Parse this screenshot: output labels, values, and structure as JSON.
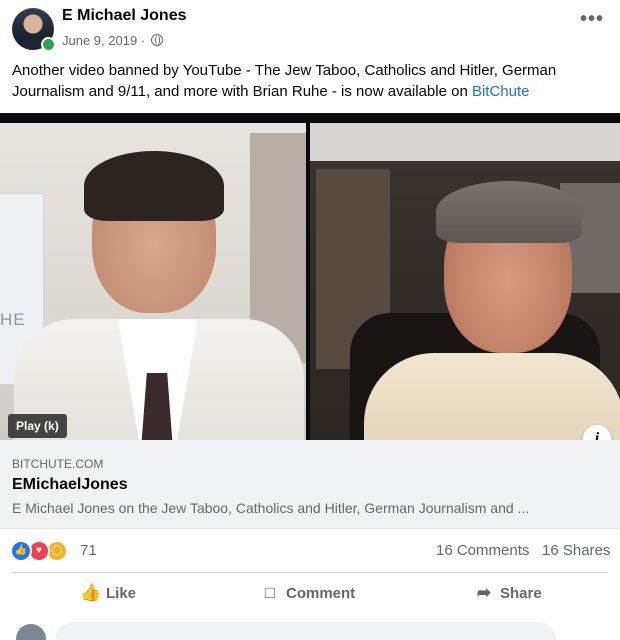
{
  "post": {
    "author": "E Michael Jones",
    "date": "June 9, 2019 ·",
    "privacy_icon": "globe-icon",
    "more_label": "•••",
    "text_before_link": "Another video banned by YouTube - The Jew Taboo, Catholics and Hitler, German Journalism and 9/11, and more with Brian Ruhe - is now available on ",
    "link_text": "BitChute"
  },
  "video": {
    "play_label": "Play (k)",
    "sign_text": "HE",
    "info_label": "i"
  },
  "link_preview": {
    "domain": "BITCHUTE.COM",
    "title": "EMichaelJones",
    "description": "E Michael Jones on the Jew Taboo, Catholics and Hitler, German Journalism and ..."
  },
  "engagement": {
    "reaction_icons": [
      "like-icon",
      "love-icon",
      "wow-icon"
    ],
    "reaction_count": "71",
    "comments": "16 Comments",
    "shares": "16 Shares"
  },
  "actions": {
    "like": "Like",
    "comment": "Comment",
    "share": "Share"
  },
  "colors": {
    "link": "#216fdb",
    "online": "#31a24c",
    "like": "#1877f2",
    "love": "#f33e58",
    "wow": "#f7b125"
  }
}
